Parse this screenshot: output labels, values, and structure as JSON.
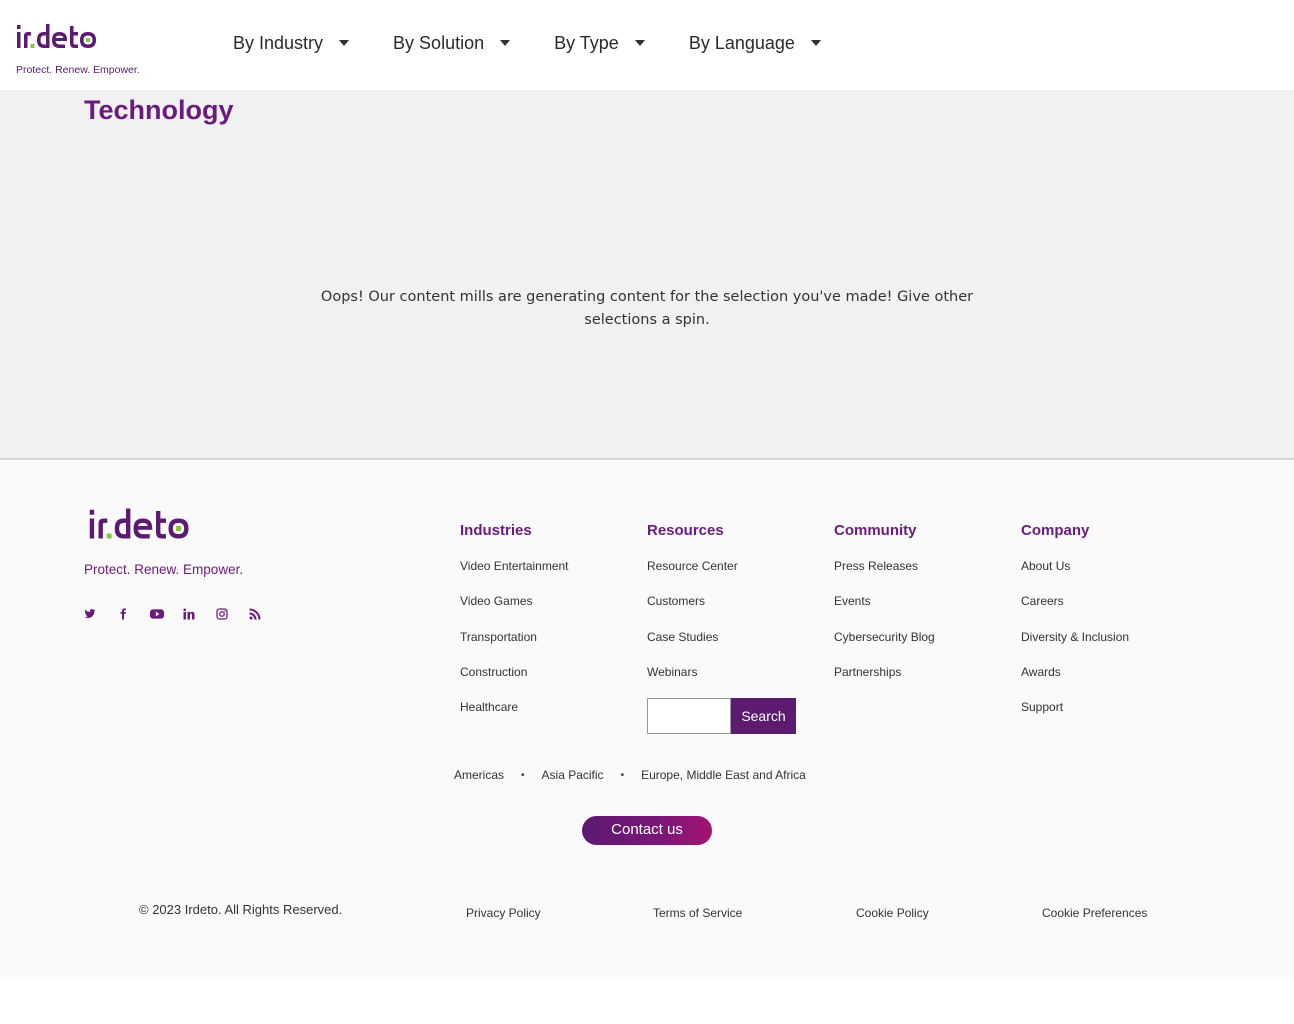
{
  "brand": {
    "name": "irdeto",
    "tagline": "Protect. Renew. Empower."
  },
  "nav": {
    "items": [
      {
        "label": "By Industry"
      },
      {
        "label": "By Solution"
      },
      {
        "label": "By Type"
      },
      {
        "label": "By Language"
      }
    ]
  },
  "main": {
    "title": "Technology",
    "empty_message": "Oops! Our content mills are generating content for the selection you've made! Give other selections a spin."
  },
  "footer": {
    "social_icons": [
      "twitter-icon",
      "facebook-icon",
      "youtube-icon",
      "linkedin-icon",
      "instagram-icon",
      "rss-icon"
    ],
    "columns": [
      {
        "title": "Industries",
        "items": [
          "Video Entertainment",
          "Video Games",
          "Transportation",
          "Construction",
          "Healthcare"
        ]
      },
      {
        "title": "Resources",
        "items": [
          "Resource Center",
          "Customers",
          "Case Studies",
          "Webinars"
        ]
      },
      {
        "title": "Community",
        "items": [
          "Press Releases",
          "Events",
          "Cybersecurity Blog",
          "Partnerships"
        ]
      },
      {
        "title": "Company",
        "items": [
          "About Us",
          "Careers",
          "Diversity & Inclusion",
          "Awards",
          "Support"
        ]
      }
    ],
    "search": {
      "button_label": "Search",
      "value": ""
    },
    "regions": [
      "Americas",
      "Asia Pacific",
      "Europe, Middle East and Africa"
    ],
    "region_separator": "•",
    "contact_label": "Contact us",
    "copyright": "© 2023 Irdeto. All Rights Reserved.",
    "legal_links": [
      "Privacy Policy",
      "Terms of Service",
      "Cookie Policy",
      "Cookie Preferences"
    ]
  },
  "colors": {
    "brand_purple": "#6b1a7e",
    "brand_green": "#8cc63f",
    "main_bg": "#f1f1f1"
  }
}
